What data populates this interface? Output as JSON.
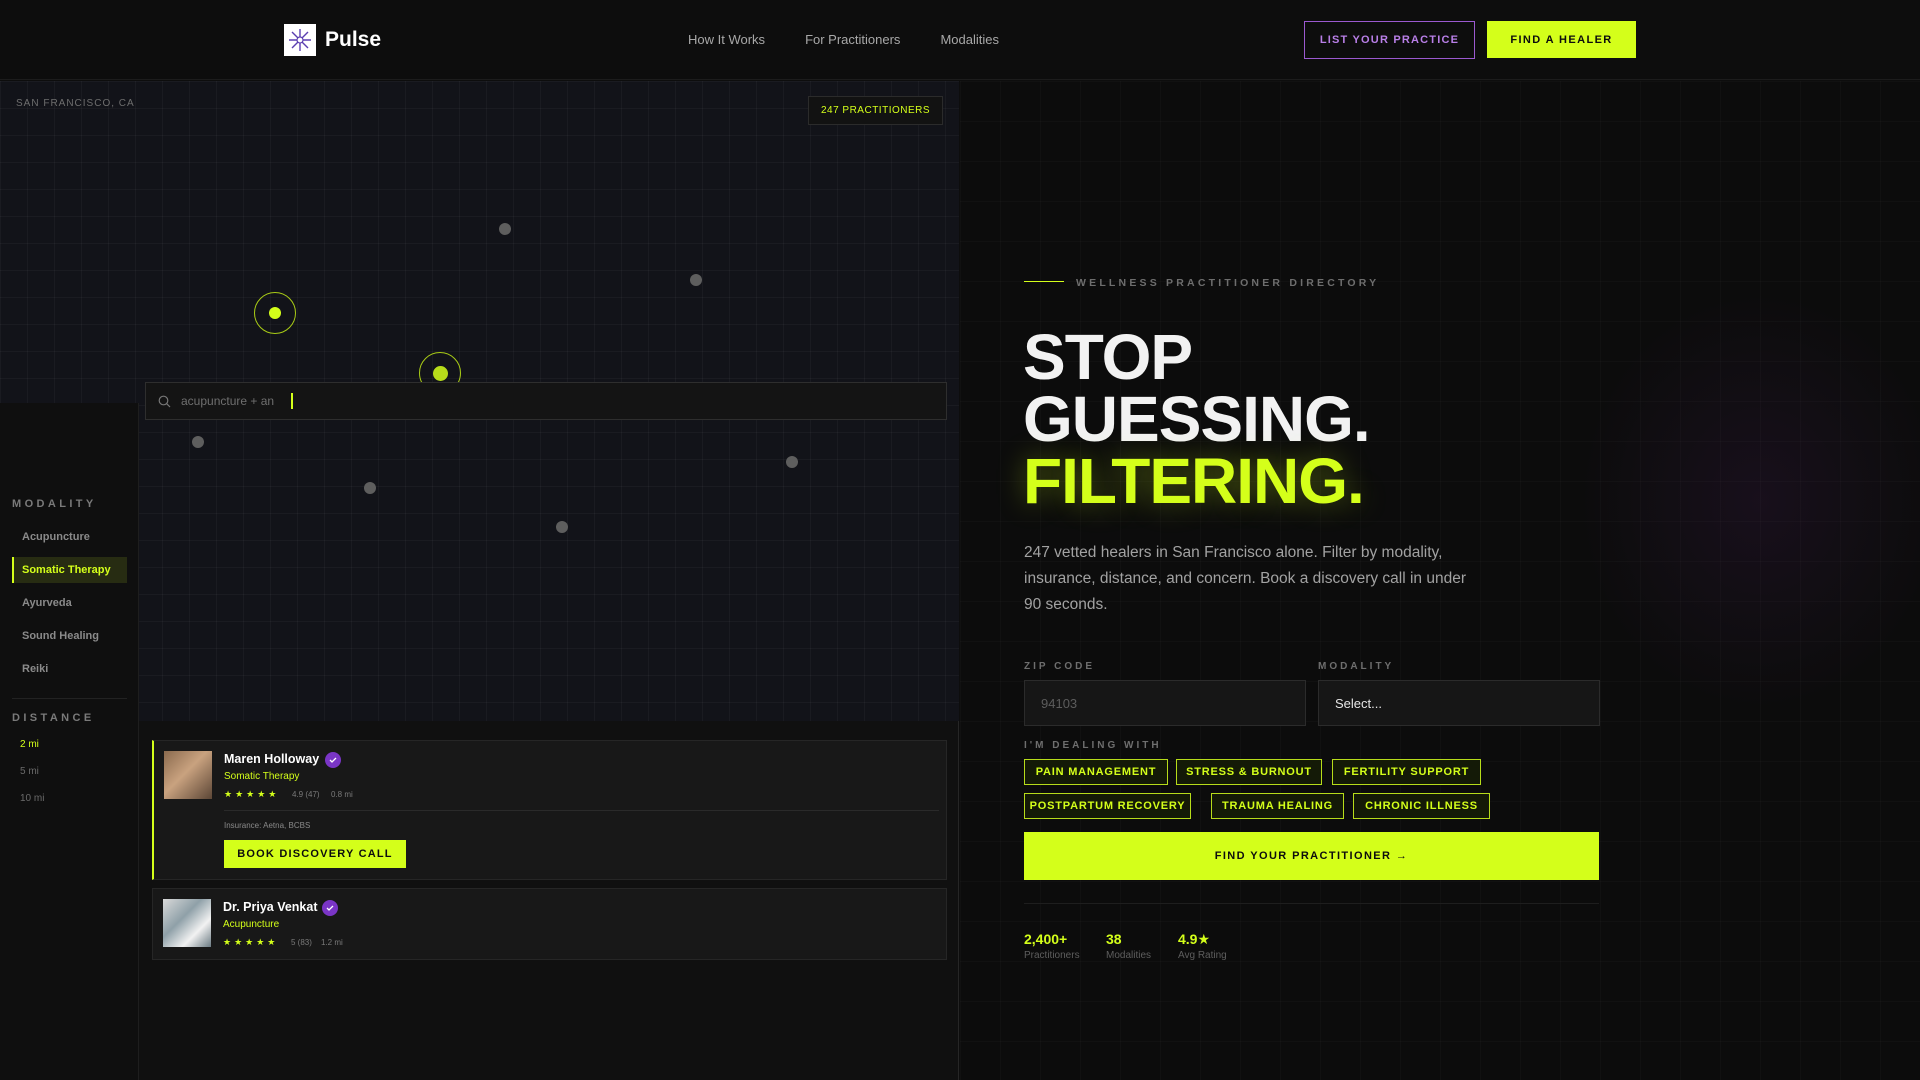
{
  "nav": {
    "brand": "Pulse",
    "links": [
      "How It Works",
      "For Practitioners",
      "Modalities"
    ],
    "list_practice": "LIST YOUR PRACTICE",
    "find_healer": "FIND A HEALER"
  },
  "map": {
    "city": "SAN FRANCISCO, CA",
    "count_badge": "247 PRACTITIONERS",
    "search_value": "acupuncture + an"
  },
  "filters": {
    "modality_heading": "MODALITY",
    "modalities": [
      "Acupuncture",
      "Somatic Therapy",
      "Ayurveda",
      "Sound Healing",
      "Reiki"
    ],
    "active_modality": "Somatic Therapy",
    "distance_heading": "DISTANCE",
    "distances": [
      "2 mi",
      "5 mi",
      "10 mi"
    ],
    "active_distance": "2 mi"
  },
  "cards": [
    {
      "name": "Maren Holloway",
      "modality": "Somatic Therapy",
      "stars": "★★★★★",
      "rating": "4.9 (47)",
      "distance": "0.8 mi",
      "insurance": "Insurance: Aetna, BCBS",
      "book_label": "BOOK DISCOVERY CALL"
    },
    {
      "name": "Dr. Priya Venkat",
      "modality": "Acupuncture",
      "stars": "★★★★★",
      "rating": "5 (83)",
      "distance": "1.2 mi"
    }
  ],
  "hero": {
    "eyebrow": "WELLNESS PRACTITIONER DIRECTORY",
    "headline_1": "STOP",
    "headline_2": "GUESSING.",
    "headline_3": "FILTERING.",
    "lede": "247 vetted healers in San Francisco alone. Filter by modality, insurance, distance, and concern. Book a discovery call in under 90 seconds.",
    "zip_label": "ZIP CODE",
    "zip_placeholder": "94103",
    "modality_label": "MODALITY",
    "modality_value": "Select...",
    "concern_label": "I'M DEALING WITH",
    "concerns": [
      "PAIN MANAGEMENT",
      "STRESS & BURNOUT",
      "FERTILITY SUPPORT",
      "POSTPARTUM RECOVERY",
      "TRAUMA HEALING",
      "CHRONIC ILLNESS"
    ],
    "cta": "FIND YOUR PRACTITIONER →",
    "stats": [
      {
        "value": "2,400+",
        "label": "Practitioners"
      },
      {
        "value": "38",
        "label": "Modalities"
      },
      {
        "value": "4.9★",
        "label": "Avg Rating"
      }
    ]
  },
  "colors": {
    "accent": "#d4ff1a",
    "purple": "#7a35c6",
    "background": "#0d0d0d"
  }
}
